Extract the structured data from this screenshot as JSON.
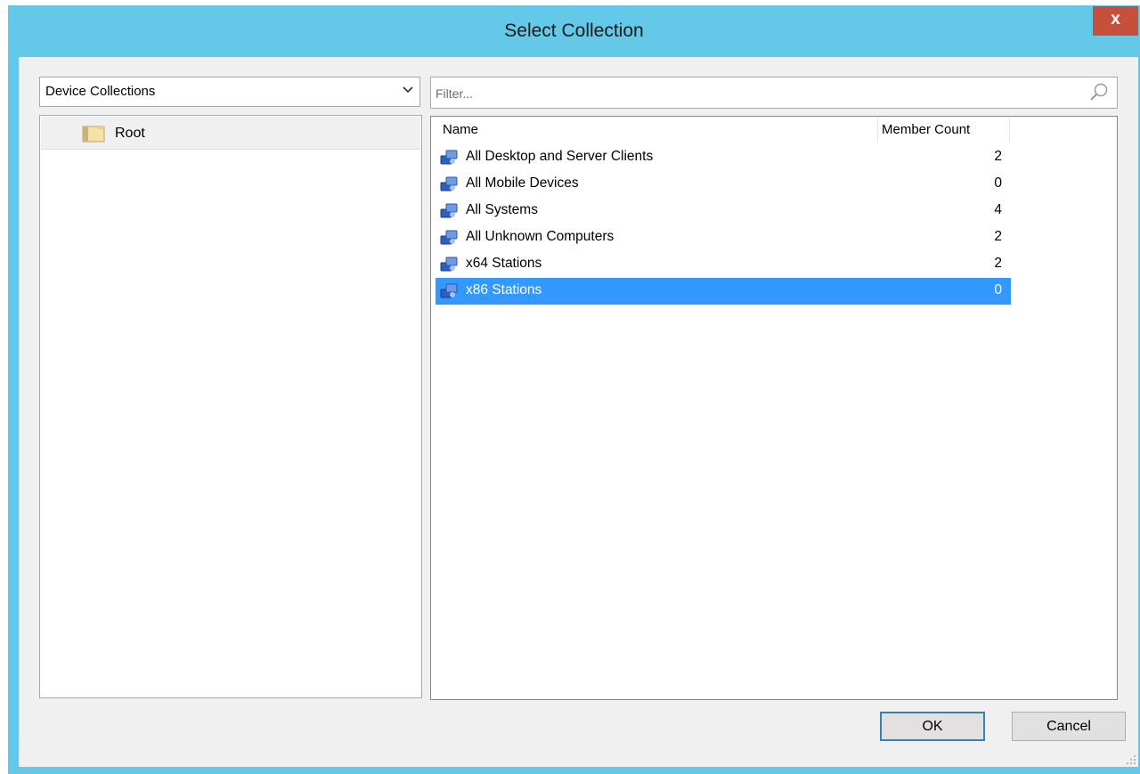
{
  "window": {
    "title": "Select Collection",
    "close_label": "x"
  },
  "left_panel": {
    "collection_type": "Device Collections",
    "tree": [
      {
        "label": "Root"
      }
    ]
  },
  "right_panel": {
    "filter_placeholder": "Filter...",
    "columns": {
      "name": "Name",
      "member_count": "Member Count"
    },
    "rows": [
      {
        "name": "All Desktop and Server Clients",
        "count": "2",
        "selected": false
      },
      {
        "name": "All Mobile Devices",
        "count": "0",
        "selected": false
      },
      {
        "name": "All Systems",
        "count": "4",
        "selected": false
      },
      {
        "name": "All Unknown Computers",
        "count": "2",
        "selected": false
      },
      {
        "name": "x64 Stations",
        "count": "2",
        "selected": false
      },
      {
        "name": "x86 Stations",
        "count": "0",
        "selected": true
      }
    ]
  },
  "buttons": {
    "ok": "OK",
    "cancel": "Cancel"
  },
  "colors": {
    "frame": "#64c8e8",
    "close": "#c7503c",
    "selection": "#3399ff"
  }
}
